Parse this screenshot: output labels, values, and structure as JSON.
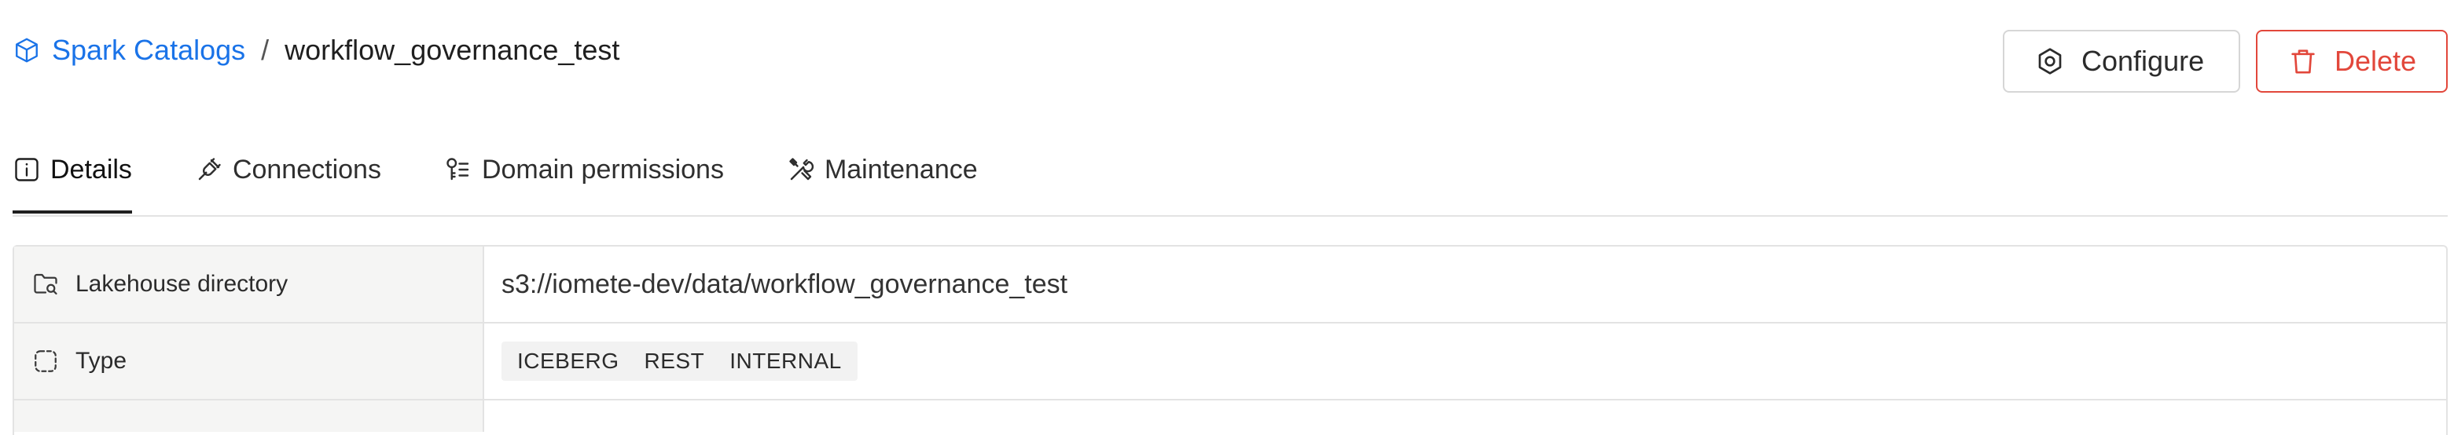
{
  "breadcrumb": {
    "parent_label": "Spark Catalogs",
    "separator": "/",
    "current": "workflow_governance_test"
  },
  "actions": {
    "configure_label": "Configure",
    "delete_label": "Delete"
  },
  "tabs": [
    {
      "label": "Details",
      "active": true
    },
    {
      "label": "Connections",
      "active": false
    },
    {
      "label": "Domain permissions",
      "active": false
    },
    {
      "label": "Maintenance",
      "active": false
    }
  ],
  "details": {
    "rows": [
      {
        "label": "Lakehouse directory",
        "value": "s3://iomete-dev/data/workflow_governance_test"
      },
      {
        "label": "Type",
        "tags": [
          "ICEBERG",
          "REST",
          "INTERNAL"
        ]
      }
    ]
  },
  "colors": {
    "link": "#1a73e8",
    "danger": "#e2473b",
    "border": "#e3e3e3",
    "label_bg": "#f5f5f4"
  }
}
